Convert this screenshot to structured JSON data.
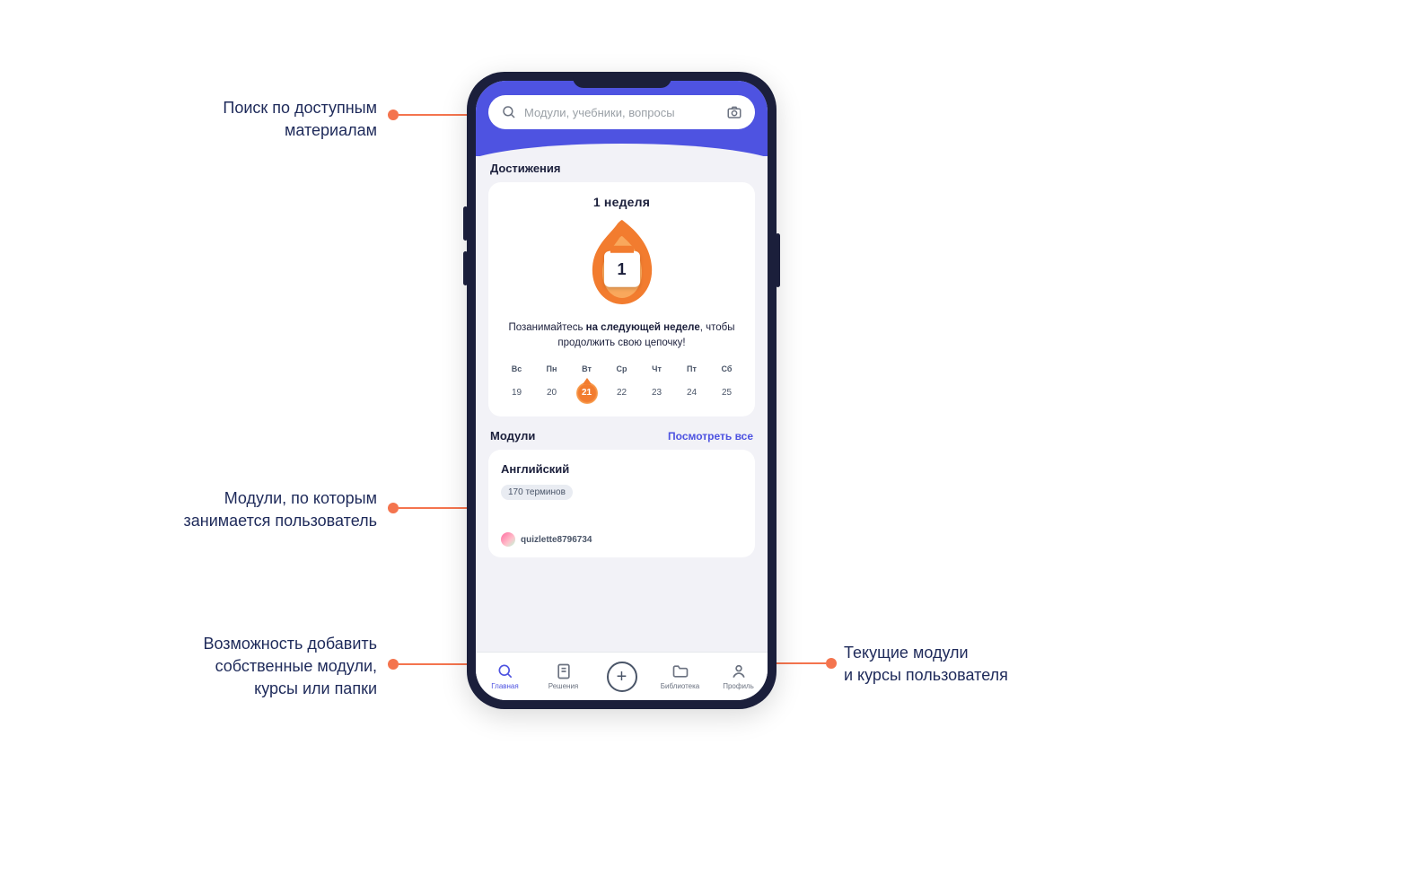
{
  "annotations": {
    "search_label": "Поиск по доступным\nматериалам",
    "modules_label": "Модули, по которым\nзанимается пользователь",
    "add_label": "Возможность добавить\nсобственные модули,\nкурсы или папки",
    "library_label": "Текущие модули\nи курсы пользователя"
  },
  "search": {
    "placeholder": "Модули, учебники, вопросы"
  },
  "sections": {
    "achievements_title": "Достижения",
    "modules_title": "Модули",
    "view_all": "Посмотреть все"
  },
  "achievements": {
    "weeks_title": "1 неделя",
    "streak_number": "1",
    "text_prefix": "Позанимайтесь ",
    "text_bold": "на следующей неделе",
    "text_suffix": ", чтобы продолжить свою цепочку!",
    "dow": [
      "Вс",
      "Пн",
      "Вт",
      "Ср",
      "Чт",
      "Пт",
      "Сб"
    ],
    "days": [
      "19",
      "20",
      "21",
      "22",
      "23",
      "24",
      "25"
    ],
    "active_day_index": 2
  },
  "module": {
    "title": "Английский",
    "terms": "170 терминов",
    "user": "quizlette8796734"
  },
  "nav": {
    "home": "Главная",
    "solutions": "Решения",
    "library": "Библиотека",
    "profile": "Профиль"
  }
}
